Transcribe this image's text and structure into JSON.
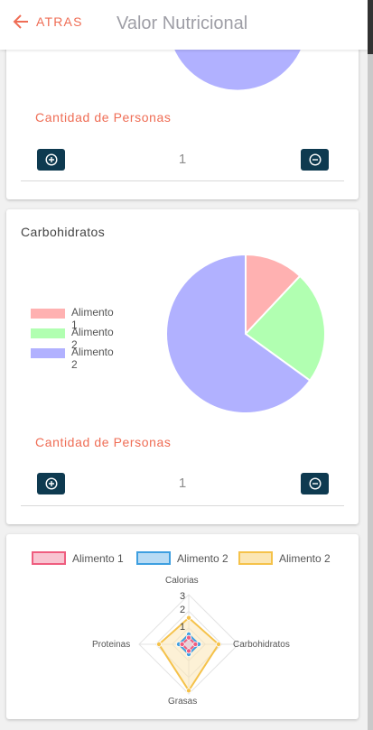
{
  "header": {
    "back_label": "ATRAS",
    "title": "Valor Nutricional"
  },
  "card1": {
    "persons_label": "Cantidad de Personas",
    "count": "1"
  },
  "card2": {
    "title": "Carbohidratos",
    "legend": [
      {
        "label": "Alimento 1",
        "color": "#ffb1b1"
      },
      {
        "label": "Alimento 2",
        "color": "#b1ffb1"
      },
      {
        "label": "Alimento 2",
        "color": "#b1b1ff"
      }
    ],
    "persons_label": "Cantidad de Personas",
    "count": "1"
  },
  "card3": {
    "legend": [
      {
        "label": "Alimento 1",
        "border": "#ef5d7f",
        "fill": "#f8c4d1"
      },
      {
        "label": "Alimento 2",
        "border": "#3e9fe0",
        "fill": "#b8dbf4"
      },
      {
        "label": "Alimento 2",
        "border": "#f5c24a",
        "fill": "#fbe6b4"
      }
    ],
    "axes": [
      "Calorias",
      "Carbohidratos",
      "Grasas",
      "Proteinas"
    ],
    "ticks": [
      "3",
      "2",
      "1"
    ]
  },
  "colors": {
    "accent": "#ef6d55",
    "button": "#0e3a50"
  },
  "chart_data": [
    {
      "type": "pie",
      "title": "Carbohidratos",
      "categories": [
        "Alimento 1",
        "Alimento 2",
        "Alimento 2"
      ],
      "values": [
        12,
        23,
        65
      ],
      "colors": [
        "#ffb1b1",
        "#b1ffb1",
        "#b1b1ff"
      ],
      "legend": "left"
    },
    {
      "type": "radar",
      "categories": [
        "Calorias",
        "Carbohidratos",
        "Grasas",
        "Proteinas"
      ],
      "series": [
        {
          "name": "Alimento 1",
          "values": [
            0.4,
            0.4,
            0.4,
            0.4
          ]
        },
        {
          "name": "Alimento 2",
          "values": [
            0.6,
            0.6,
            0.6,
            0.6
          ]
        },
        {
          "name": "Alimento 2",
          "values": [
            1.6,
            1.8,
            2.8,
            1.8
          ]
        }
      ],
      "ylim": [
        0,
        3
      ],
      "ticks": [
        1,
        2,
        3
      ],
      "legend": "top"
    }
  ]
}
